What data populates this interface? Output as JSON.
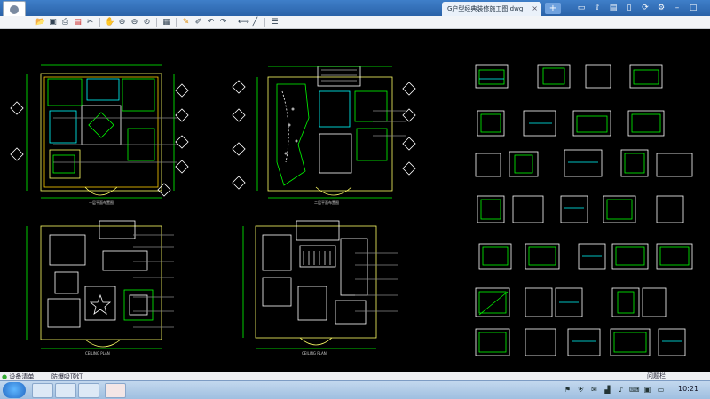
{
  "window": {
    "tab_title": "G户型经典装修施工图.dwg",
    "tab_close": "×",
    "tab_add": "+",
    "icons": [
      "window-icon",
      "share-icon",
      "folder-icon",
      "phone-icon",
      "sync-icon",
      "settings-icon"
    ]
  },
  "toolbar": {
    "tools": [
      "open-icon",
      "save-icon",
      "print-icon",
      "pdf-icon",
      "cut-icon",
      "pan-icon",
      "zoom-in-icon",
      "zoom-out-icon",
      "zoom-window-icon",
      "sep",
      "layout-icon",
      "sep",
      "pencil-icon",
      "text-icon",
      "undo-icon",
      "redo-icon",
      "sep",
      "measure-icon",
      "line-icon",
      "sep",
      "layers-icon"
    ]
  },
  "drawings": {
    "plan_1_label": "一层平面布置图",
    "plan_2_label": "二层平面布置图",
    "ceiling_1_label": "CEILING PLAN",
    "ceiling_2_label": "CEILING PLAN"
  },
  "statusbar": {
    "item_1": "设备清单",
    "item_2": "防爆吸顶灯",
    "help": "问题栏"
  },
  "taskbar": {
    "clock": "10:21"
  }
}
